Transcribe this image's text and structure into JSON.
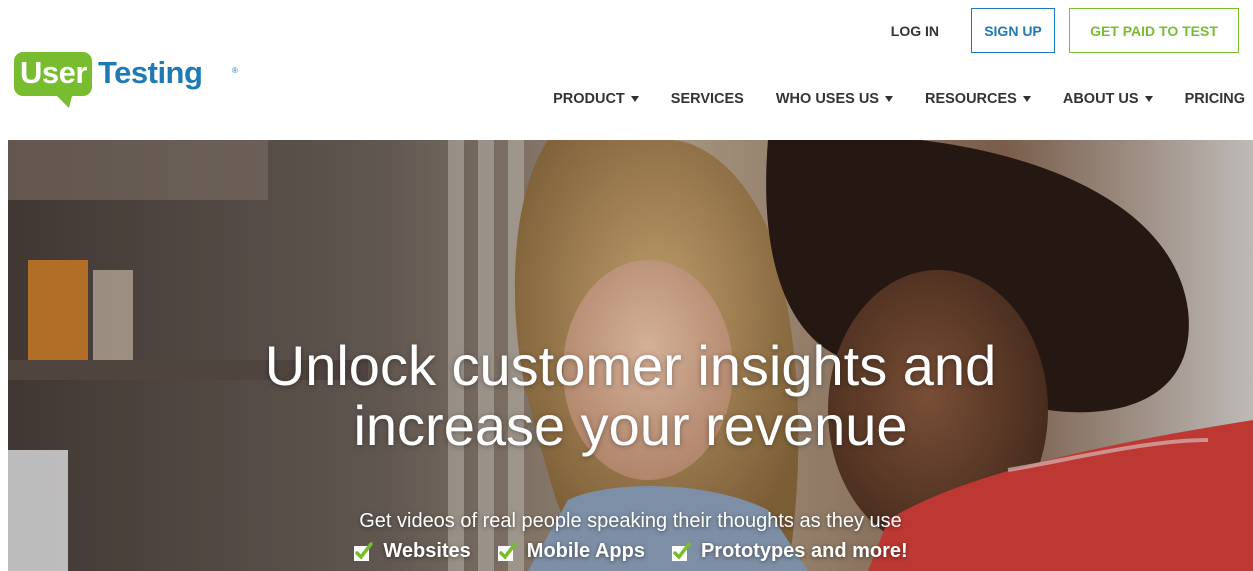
{
  "header": {
    "logo": {
      "part1": "User",
      "part2": "Testing",
      "reg": "®"
    },
    "top_links": {
      "login": "LOG IN",
      "signup": "SIGN UP",
      "get_paid": "GET PAID TO TEST"
    },
    "nav": [
      {
        "label": "PRODUCT",
        "dropdown": true
      },
      {
        "label": "SERVICES",
        "dropdown": false
      },
      {
        "label": "WHO USES US",
        "dropdown": true
      },
      {
        "label": "RESOURCES",
        "dropdown": true
      },
      {
        "label": "ABOUT US",
        "dropdown": true
      },
      {
        "label": "PRICING",
        "dropdown": false
      }
    ]
  },
  "hero": {
    "title_line1": "Unlock customer insights and",
    "title_line2": "increase your revenue",
    "subtitle": "Get videos of real people speaking their thoughts as they use",
    "features": [
      "Websites",
      "Mobile Apps",
      "Prototypes and more!"
    ]
  },
  "colors": {
    "brand_green": "#78bd2f",
    "brand_blue": "#1c7bb5",
    "nav_text": "#333333"
  },
  "icons": {
    "feature_check": "checkbox-check-icon",
    "nav_caret": "caret-down-icon"
  }
}
